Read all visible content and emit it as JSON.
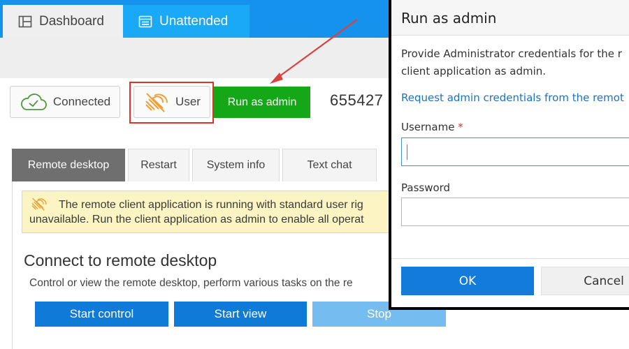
{
  "nav": {
    "tabs": [
      {
        "label": "Dashboard",
        "icon": "dashboard-icon",
        "active": false
      },
      {
        "label": "Unattended",
        "icon": "unattended-icon",
        "active": true
      }
    ]
  },
  "status": {
    "connection_label": "Connected",
    "connection_icon": "cloud-check-icon",
    "user_label": "User",
    "user_icon": "no-admin-icon",
    "run_as_admin_label": "Run as admin",
    "client_id": "655427"
  },
  "tabs": [
    {
      "label": "Remote desktop",
      "active": true
    },
    {
      "label": "Restart",
      "active": false
    },
    {
      "label": "System info",
      "active": false
    },
    {
      "label": "Text chat",
      "active": false
    }
  ],
  "warning": {
    "line1": "The remote client application is running with standard user rig",
    "line2": "unavailable. Run the client application as admin to enable all operat"
  },
  "section": {
    "title": "Connect to remote desktop",
    "description": "Control or view the remote desktop, perform various tasks on the re",
    "buttons": {
      "start_control": "Start control",
      "start_view": "Start view",
      "stop": "Stop"
    }
  },
  "modal": {
    "title": "Run as admin",
    "description_line1": "Provide Administrator credentials for the r",
    "description_line2": "client application as admin.",
    "link": "Request admin credentials from the remot",
    "username_label": "Username",
    "username_required": "*",
    "username_value": "",
    "password_label": "Password",
    "password_value": "",
    "ok_label": "OK",
    "cancel_label": "Cancel"
  },
  "colors": {
    "nav_bar": "#1592ee",
    "active_nav_tab": "#19a9f6",
    "run_as_admin": "#14a818",
    "primary_button": "#0f7ad8",
    "disabled_button": "#75bdf0",
    "warning_bg": "#fdf4c3",
    "annotation_red": "#e0322b",
    "link": "#1a73c8"
  }
}
